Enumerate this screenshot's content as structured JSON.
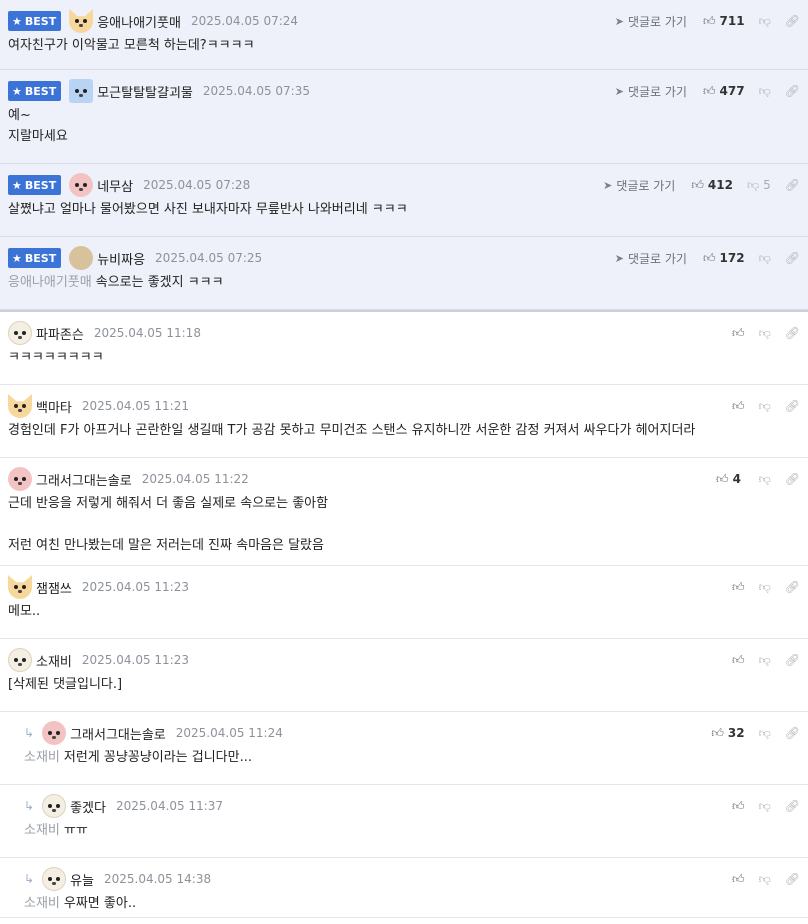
{
  "comments": [
    {
      "best": true,
      "badge": "BEST",
      "avatar": "fox-icon",
      "nick": "응애나애기풋매",
      "date": "2025.04.05 07:24",
      "goto": "댓글로 가기",
      "likes": "711",
      "dislikes": "",
      "lines": [
        "여자친구가 이악물고 모른척 하는데?ㅋㅋㅋㅋ"
      ]
    },
    {
      "best": true,
      "badge": "BEST",
      "avatar": "blue-character-icon",
      "nick": "모근탈탈탈걀괴물",
      "date": "2025.04.05 07:35",
      "goto": "댓글로 가기",
      "likes": "477",
      "dislikes": "",
      "lines": [
        "예~",
        "지랄마세요"
      ]
    },
    {
      "best": true,
      "badge": "BEST",
      "avatar": "pink-dog-icon",
      "nick": "네무삼",
      "date": "2025.04.05 07:28",
      "goto": "댓글로 가기",
      "likes": "412",
      "dislikes": "5",
      "lines": [
        "살쪘냐고 얼마나 물어봤으면 사진 보내자마자 무릎반사 나와버리네 ㅋㅋㅋ"
      ]
    },
    {
      "best": true,
      "badge": "BEST",
      "avatar": "bread-icon",
      "nick": "뉴비짜응",
      "date": "2025.04.05 07:25",
      "goto": "댓글로 가기",
      "likes": "172",
      "dislikes": "",
      "mention": "응애나애기풋매",
      "lines": [
        "속으로는 좋겠지 ㅋㅋㅋ"
      ]
    },
    {
      "best": false,
      "avatar": "dog-icon",
      "nick": "파파존슨",
      "date": "2025.04.05 11:18",
      "likes": "",
      "dislikes": "",
      "lines": [
        "ㅋㅋㅋㅋㅋㅋㅋㅋ"
      ]
    },
    {
      "best": false,
      "avatar": "fox-icon",
      "nick": "백마타",
      "date": "2025.04.05 11:21",
      "likes": "",
      "dislikes": "",
      "lines": [
        "경험인데 F가 아프거나 곤란한일 생길때 T가 공감 못하고 무미건조 스탠스 유지하니깐 서운한 감정 커져서 싸우다가 헤어지더라"
      ]
    },
    {
      "best": false,
      "avatar": "pink-dog-icon",
      "nick": "그래서그대는솔로",
      "date": "2025.04.05 11:22",
      "likes": "4",
      "dislikes": "",
      "lines": [
        "근데 반응을 저렇게 해줘서 더 좋음 실제로 속으로는 좋아함",
        "",
        "저런 여친 만나봤는데 말은 저러는데 진짜 속마음은 달랐음"
      ]
    },
    {
      "best": false,
      "avatar": "fox-icon",
      "nick": "잼잼쓰",
      "date": "2025.04.05 11:23",
      "likes": "",
      "dislikes": "",
      "lines": [
        "메모.."
      ]
    },
    {
      "best": false,
      "avatar": "dog-icon",
      "nick": "소재비",
      "date": "2025.04.05 11:23",
      "likes": "",
      "dislikes": "",
      "lines": [
        "[삭제된 댓글입니다.]"
      ]
    },
    {
      "best": false,
      "reply": true,
      "avatar": "pink-dog-icon",
      "nick": "그래서그대는솔로",
      "date": "2025.04.05 11:24",
      "likes": "32",
      "dislikes": "",
      "mention": "소재비",
      "lines": [
        "저런게 꽁냥꽁냥이라는 겁니다만..."
      ]
    },
    {
      "best": false,
      "reply": true,
      "avatar": "dog-icon",
      "nick": "좋겠다",
      "date": "2025.04.05 11:37",
      "likes": "",
      "dislikes": "",
      "mention": "소재비",
      "lines": [
        "ㅠㅠ"
      ]
    },
    {
      "best": false,
      "reply": true,
      "avatar": "dog-icon",
      "nick": "유늘",
      "date": "2025.04.05 14:38",
      "likes": "",
      "dislikes": "",
      "mention": "소재비",
      "lines": [
        "우짜면 좋아.."
      ]
    }
  ],
  "colors": {
    "best_bg": "#eef1f9",
    "badge": "#3b73d6",
    "date": "#8d929a",
    "mention": "#9aa0a8"
  },
  "icons": {
    "goto": "arrow-icon",
    "like": "thumbs-up-icon",
    "dislike": "thumbs-down-icon",
    "link": "link-icon",
    "star": "star-icon",
    "reply": "reply-arrow-icon"
  }
}
